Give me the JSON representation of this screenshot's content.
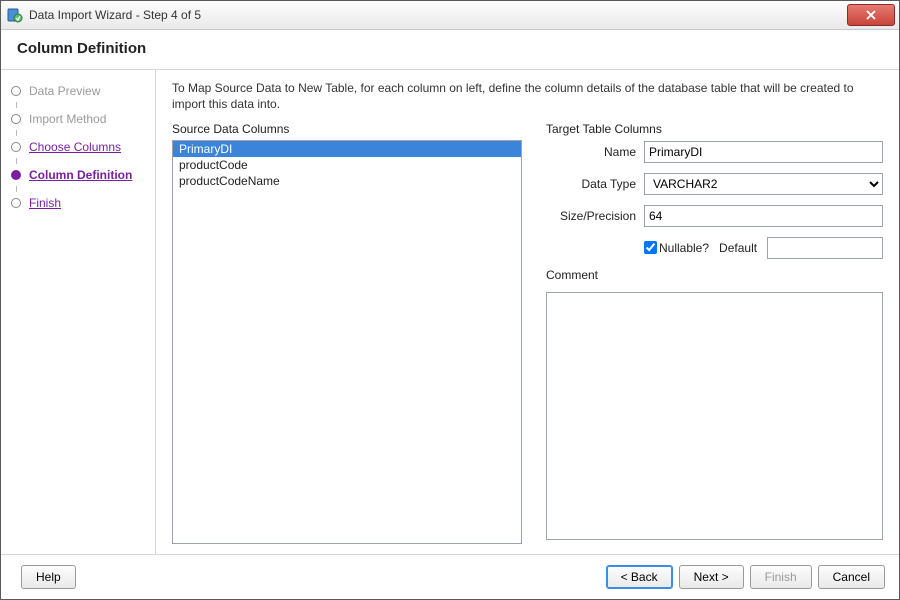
{
  "window": {
    "title": "Data Import Wizard - Step 4 of 5"
  },
  "header": {
    "title": "Column Definition"
  },
  "sidebar": {
    "steps": [
      {
        "label": "Data Preview",
        "state": "done"
      },
      {
        "label": "Import Method",
        "state": "done"
      },
      {
        "label": "Choose Columns",
        "state": "link"
      },
      {
        "label": "Column Definition",
        "state": "current"
      },
      {
        "label": "Finish",
        "state": "link"
      }
    ]
  },
  "main": {
    "instructions": "To Map Source Data to New Table, for each column on left, define the column details of the database table that will be created to import this data into.",
    "source": {
      "group_label": "Source Data Columns",
      "items": [
        "PrimaryDI",
        "productCode",
        "productCodeName"
      ],
      "selected_index": 0
    },
    "target": {
      "group_label": "Target Table Columns",
      "labels": {
        "name": "Name",
        "data_type": "Data Type",
        "size_precision": "Size/Precision",
        "nullable": "Nullable?",
        "default": "Default",
        "comment": "Comment"
      },
      "values": {
        "name": "PrimaryDI",
        "data_type": "VARCHAR2",
        "size_precision": "64",
        "nullable": true,
        "default": "",
        "comment": ""
      }
    }
  },
  "footer": {
    "help": "Help",
    "back": "< Back",
    "next": "Next >",
    "finish": "Finish",
    "cancel": "Cancel"
  }
}
